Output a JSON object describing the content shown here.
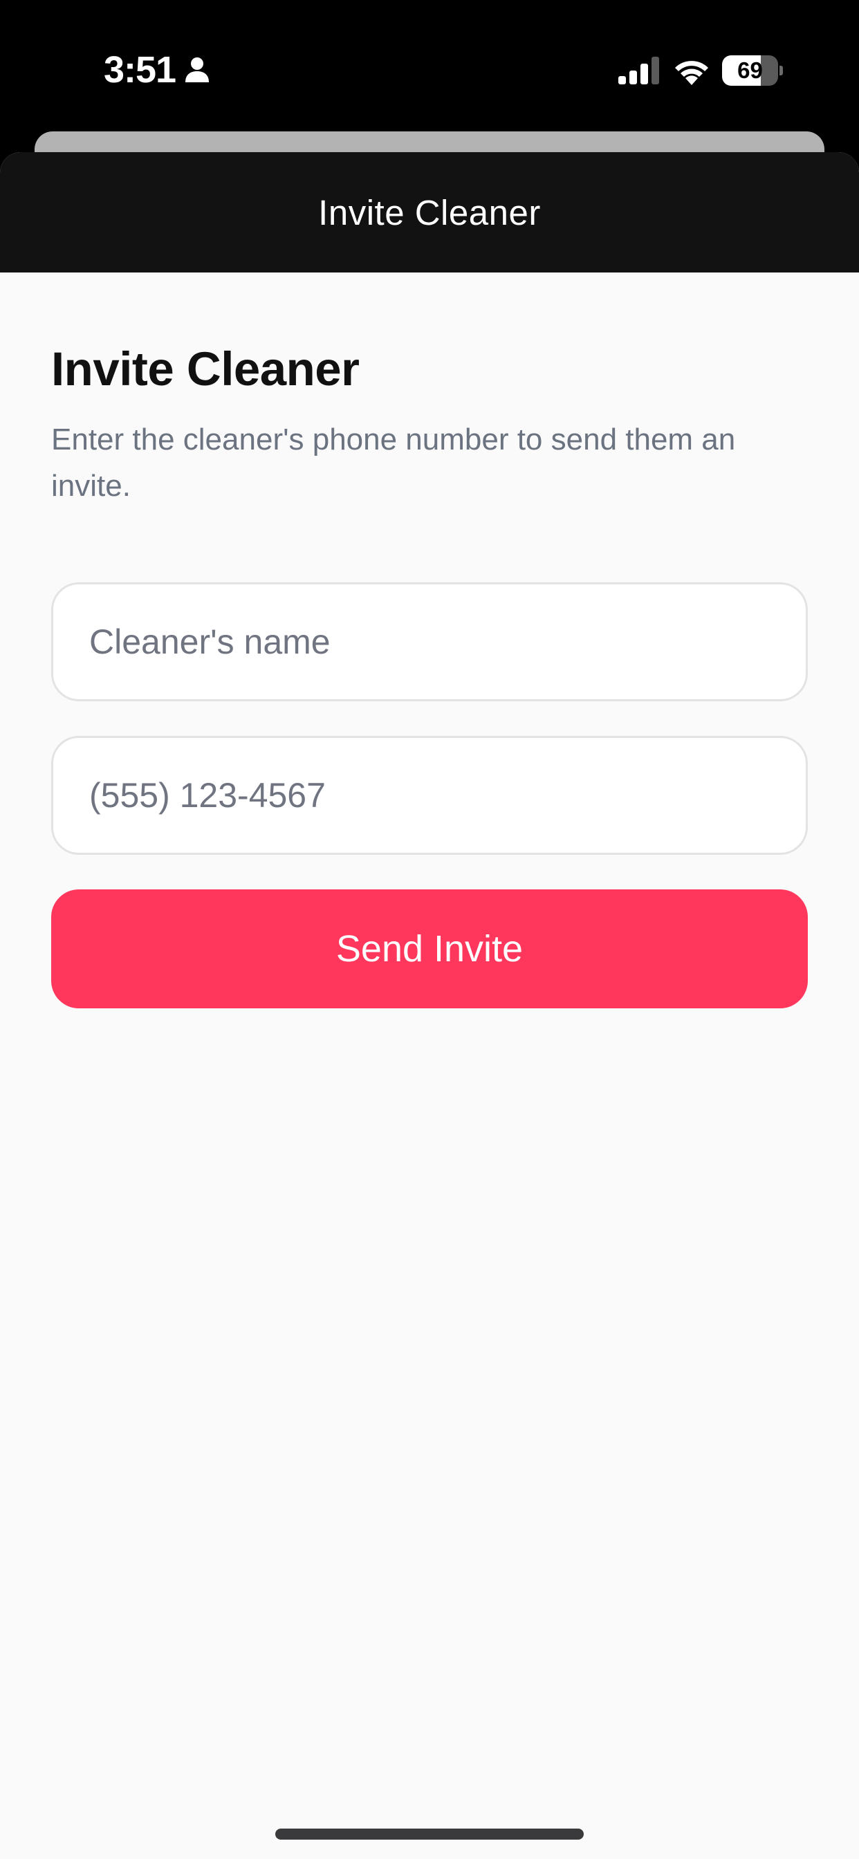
{
  "status_bar": {
    "time": "3:51",
    "battery_percent": "69",
    "battery_level": 0.69,
    "icons": [
      "person-icon",
      "cellular-signal-icon",
      "wifi-icon",
      "battery-icon"
    ]
  },
  "header": {
    "title": "Invite Cleaner"
  },
  "main": {
    "title": "Invite Cleaner",
    "subtitle": "Enter the cleaner's phone number to send them an invite.",
    "name_field": {
      "placeholder": "Cleaner's name",
      "value": ""
    },
    "phone_field": {
      "placeholder": "(555) 123-4567",
      "value": ""
    },
    "send_button_label": "Send Invite"
  },
  "colors": {
    "accent": "#ff375c",
    "header_background": "#121212",
    "page_background": "#fafafa",
    "subtitle_text": "#6b7280"
  }
}
